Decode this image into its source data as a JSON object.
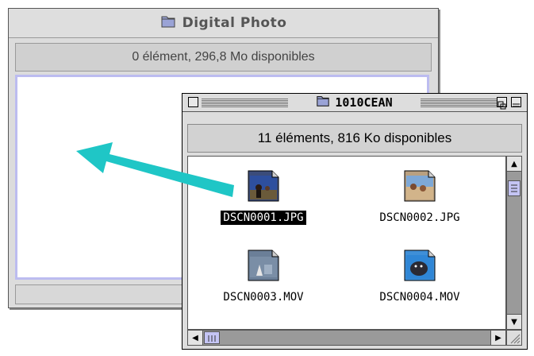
{
  "back_window": {
    "title": "Digital Photo",
    "info": "0 élément, 296,8 Mo disponibles"
  },
  "front_window": {
    "title": "1010CEAN",
    "info": "11 éléments, 816  Ko disponibles",
    "files": [
      {
        "name": "DSCN0001.JPG",
        "selected": true
      },
      {
        "name": "DSCN0002.JPG",
        "selected": false
      },
      {
        "name": "DSCN0003.MOV",
        "selected": false
      },
      {
        "name": "DSCN0004.MOV",
        "selected": false
      }
    ]
  },
  "colors": {
    "drag_arrow": "#1fc6c6",
    "scroll_thumb": "#c4c4f4",
    "selection_bg": "#000000"
  },
  "icons": [
    "folder-icon",
    "image-file-icon",
    "movie-file-icon",
    "drag-arrow-icon"
  ]
}
